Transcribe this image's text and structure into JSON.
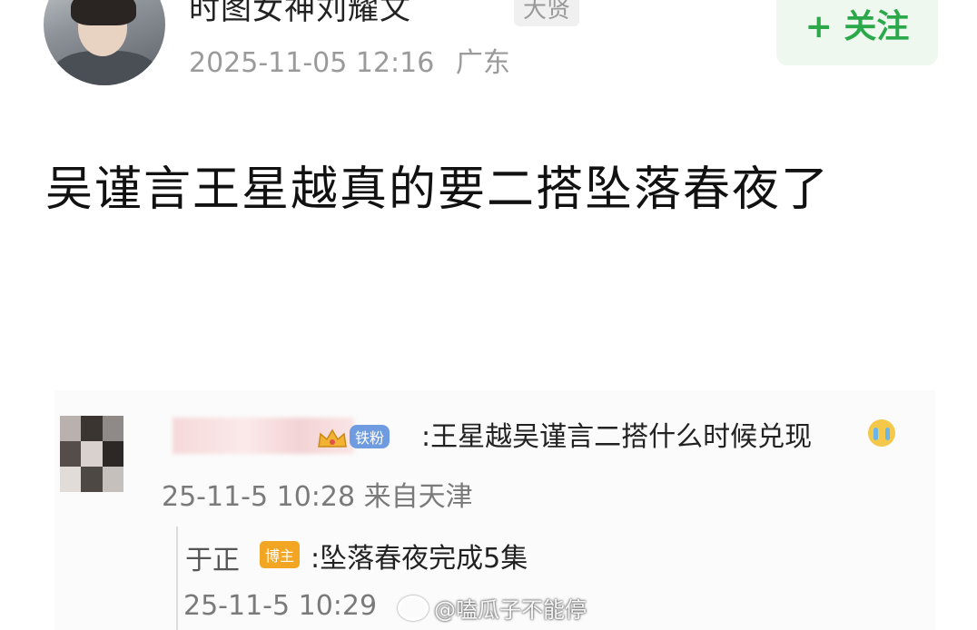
{
  "post": {
    "author": {
      "name": "时图女神刘耀文",
      "badge": "大贤",
      "timestamp": "2025-11-05 12:16",
      "location": "广东"
    },
    "follow_button": {
      "icon": "plus-icon",
      "label": "+ 关注"
    },
    "text": "吴谨言王星越真的要二搭坠落春夜了"
  },
  "embedded_screenshot": {
    "comment": {
      "badge_icon": "crown-icon",
      "badge_label": "铁粉",
      "text": ":王星越吴谨言二搭什么时候兑现",
      "emoji_icon": "crying-face-icon",
      "meta": "25-11-5 10:28 来自天津"
    },
    "reply": {
      "name": "于正",
      "badge_label": "博主",
      "text": ":坠落春夜完成5集",
      "meta": "25-11-5 10:29"
    }
  },
  "watermark": {
    "icon": "weibo-logo-icon",
    "text": "@嗑瓜子不能停"
  },
  "colors": {
    "follow_text": "#2aa84a",
    "follow_bg": "#eef8ef",
    "meta_gray": "#9a9a9a",
    "fan_badge": "#6f9ce0",
    "blogger_badge": "#f3a623"
  }
}
